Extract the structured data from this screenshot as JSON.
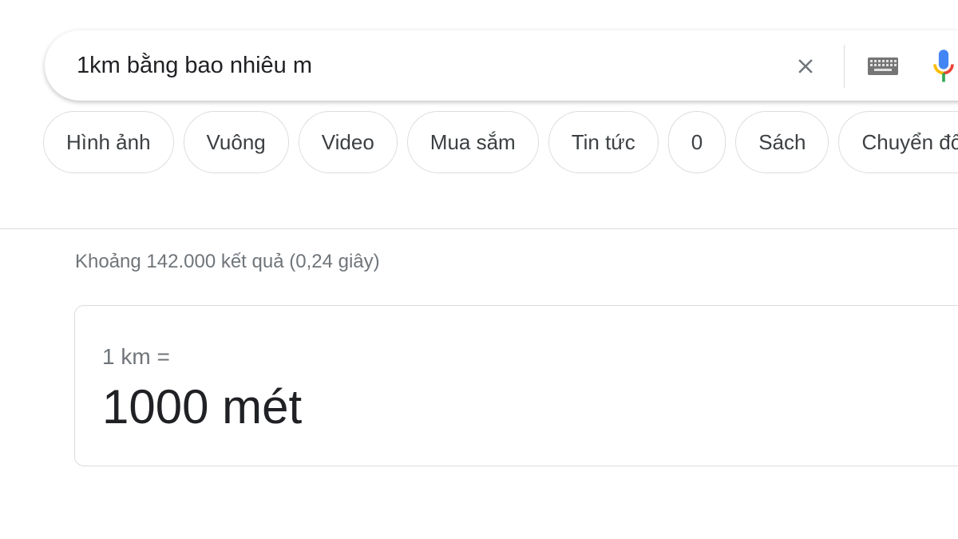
{
  "search": {
    "query": "1km bằng bao nhiêu m",
    "icons": {
      "clear": "close-icon",
      "keyboard": "keyboard-icon",
      "mic": "microphone-icon"
    },
    "colors": {
      "mic_blue": "#4285f4",
      "mic_red": "#ea4335",
      "mic_yellow": "#fbbc04",
      "mic_green": "#34a853"
    }
  },
  "chips": [
    {
      "label": "Hình ảnh"
    },
    {
      "label": "Vuông"
    },
    {
      "label": "Video"
    },
    {
      "label": "Mua sắm"
    },
    {
      "label": "Tin tức"
    },
    {
      "label": "0"
    },
    {
      "label": "Sách"
    },
    {
      "label": "Chuyển đổi"
    }
  ],
  "results": {
    "stats": "Khoảng 142.000 kết quả (0,24 giây)"
  },
  "answer": {
    "lhs": "1 km =",
    "rhs": "1000 mét"
  }
}
